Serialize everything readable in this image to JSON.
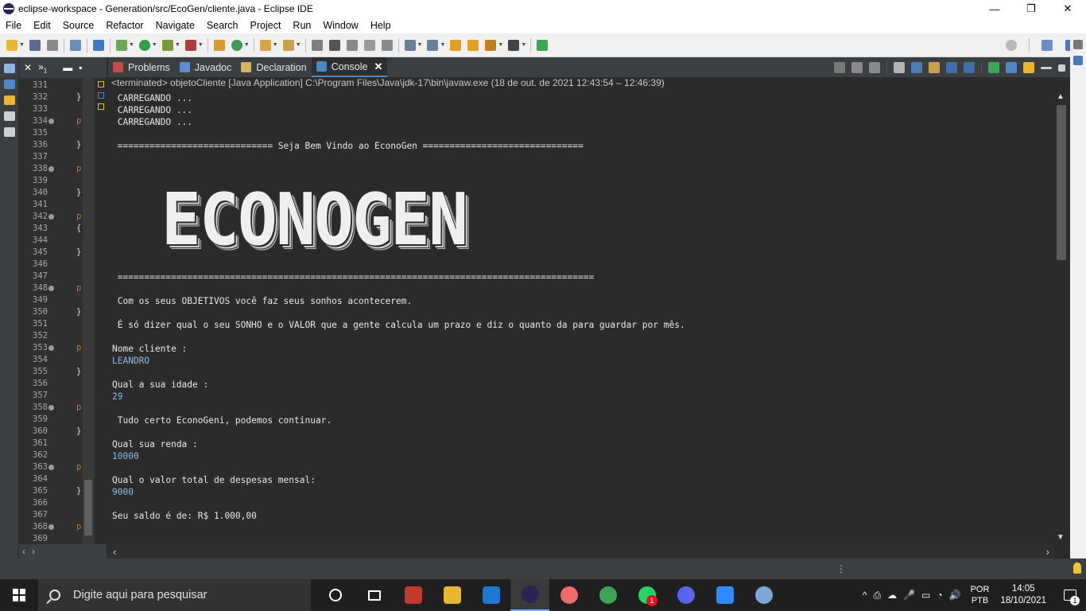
{
  "window": {
    "title": "eclipse-workspace - Generation/src/EcoGen/cliente.java - Eclipse IDE",
    "minimize": "—",
    "maximize": "❐",
    "close": "✕"
  },
  "menu": [
    "File",
    "Edit",
    "Source",
    "Refactor",
    "Navigate",
    "Search",
    "Project",
    "Run",
    "Window",
    "Help"
  ],
  "editor": {
    "close_glyph": "✕",
    "more_glyph": "»",
    "more_count": "1",
    "line_numbers": [
      "331",
      "332",
      "333",
      "334",
      "335",
      "336",
      "337",
      "338",
      "339",
      "340",
      "341",
      "342",
      "343",
      "344",
      "345",
      "346",
      "347",
      "348",
      "349",
      "350",
      "351",
      "352",
      "353",
      "354",
      "355",
      "356",
      "357",
      "358",
      "359",
      "360",
      "361",
      "362",
      "363",
      "364",
      "365",
      "366",
      "367",
      "368",
      "369"
    ],
    "fold_lines": [
      "334",
      "338",
      "342",
      "348",
      "353",
      "358",
      "363",
      "368"
    ],
    "code_glyphs": {
      "332": "}",
      "334": "p",
      "336": "}",
      "338": "p",
      "340": "}",
      "342": "p",
      "343": "{",
      "345": "}",
      "348": "p",
      "350": "}",
      "353": "p",
      "355": "}",
      "358": "p",
      "360": "}",
      "363": "p",
      "365": "}",
      "368": "p"
    },
    "hscroll_left": "‹",
    "hscroll_right": "›"
  },
  "console": {
    "tabs": [
      {
        "label": "Problems",
        "icon": "problems-icon",
        "color": "#c94a4a"
      },
      {
        "label": "Javadoc",
        "icon": "javadoc-icon",
        "color": "#5b8ccf"
      },
      {
        "label": "Declaration",
        "icon": "declaration-icon",
        "color": "#d6b45a"
      },
      {
        "label": "Console",
        "icon": "console-icon",
        "color": "#4a88c7",
        "active": true
      }
    ],
    "tab_close": "✕",
    "status_line": "<terminated> objetoCliente [Java Application] C:\\Program Files\\Java\\jdk-17\\bin\\javaw.exe  (18 de out. de 2021 12:43:54 – 12:46:39)",
    "banner": "ECONOGEN",
    "lines": [
      {
        "text": " CARREGANDO ...",
        "kind": "out"
      },
      {
        "text": " CARREGANDO ...",
        "kind": "out"
      },
      {
        "text": " CARREGANDO ...",
        "kind": "out"
      },
      {
        "text": " ============================= Seja Bem Vindo ao EconoGen ==============================",
        "kind": "out"
      },
      {
        "text": " =========================================================================================",
        "kind": "out"
      },
      {
        "text": " Com os seus OBJETIVOS você faz seus sonhos acontecerem.",
        "kind": "out"
      },
      {
        "text": " É só dizer qual o seu SONHO e o VALOR que a gente calcula um prazo e diz o quanto da para guardar por mês.",
        "kind": "out"
      },
      {
        "text": "Nome cliente :",
        "kind": "out"
      },
      {
        "text": "LEANDRO",
        "kind": "in"
      },
      {
        "text": "Qual a sua idade :",
        "kind": "out"
      },
      {
        "text": "29",
        "kind": "in"
      },
      {
        "text": " Tudo certo EconoGeni, podemos continuar.",
        "kind": "out"
      },
      {
        "text": "Qual sua renda :",
        "kind": "out"
      },
      {
        "text": "10000",
        "kind": "in"
      },
      {
        "text": "Qual o valor total de despesas mensal:",
        "kind": "out"
      },
      {
        "text": "9000",
        "kind": "in"
      },
      {
        "text": "Seu saldo é de: R$ 1.000,00",
        "kind": "out"
      }
    ],
    "scroll_up": "▲",
    "scroll_down": "▼",
    "hscroll_left": "‹",
    "hscroll_right": "›"
  },
  "taskbar": {
    "search_placeholder": "Digite aqui para pesquisar",
    "apps": [
      {
        "name": "cortana-icon",
        "color": "#1f1f1f"
      },
      {
        "name": "task-view-icon",
        "color": "#1f1f1f"
      },
      {
        "name": "equalizer-app-icon",
        "color": "#c23a2a"
      },
      {
        "name": "file-explorer-icon",
        "color": "#e8b730"
      },
      {
        "name": "mail-icon",
        "color": "#1d78d4"
      },
      {
        "name": "eclipse-icon",
        "color": "#2c2255",
        "active": true
      },
      {
        "name": "asana-icon",
        "color": "#f06a6a"
      },
      {
        "name": "chrome-icon",
        "color": "#3aa757"
      },
      {
        "name": "whatsapp-icon",
        "color": "#25d366",
        "badge": "1"
      },
      {
        "name": "discord-icon",
        "color": "#5865f2"
      },
      {
        "name": "zoom-icon",
        "color": "#2d8cff"
      },
      {
        "name": "paint-icon",
        "color": "#7aa9d8"
      }
    ],
    "tray_icons": [
      "^",
      "⎙",
      "☁",
      "🎤",
      "▭",
      "◔",
      "🔊"
    ],
    "lang_top": "POR",
    "lang_bottom": "PTB",
    "time": "14:05",
    "date": "18/10/2021",
    "notifications": "1"
  }
}
